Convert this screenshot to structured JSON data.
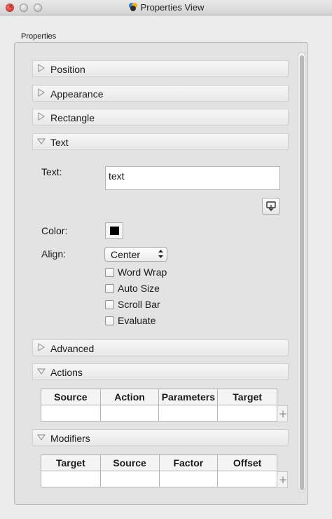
{
  "window": {
    "title": "Properties View"
  },
  "panel": {
    "label": "Properties"
  },
  "sections": {
    "position": "Position",
    "appearance": "Appearance",
    "rectangle": "Rectangle",
    "text": "Text",
    "advanced": "Advanced",
    "actions": "Actions",
    "modifiers": "Modifiers"
  },
  "text_section": {
    "text_label": "Text:",
    "text_value": "text",
    "color_label": "Color:",
    "color_value": "#000000",
    "align_label": "Align:",
    "align_value": "Center",
    "checkboxes": {
      "word_wrap": "Word Wrap",
      "auto_size": "Auto Size",
      "scroll_bar": "Scroll Bar",
      "evaluate": "Evaluate"
    }
  },
  "actions_table": {
    "columns": [
      "Source",
      "Action",
      "Parameters",
      "Target"
    ]
  },
  "modifiers_table": {
    "columns": [
      "Target",
      "Source",
      "Factor",
      "Offset"
    ]
  },
  "icons": {
    "collapsed": "triangle-right-icon",
    "expanded": "triangle-down-icon",
    "add": "plus-icon",
    "insert": "insert-text-icon"
  }
}
